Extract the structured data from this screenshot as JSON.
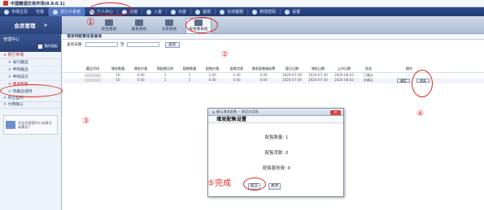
{
  "app": {
    "title": "中国糖酒交易市场(8.0.0.1)"
  },
  "topnav": {
    "items": [
      {
        "label": "市场主页",
        "icon": "home-icon"
      },
      {
        "label": "交易",
        "icon": "trade-icon"
      },
      {
        "label": "发行子系统",
        "icon": "issue-icon",
        "active": true
      },
      {
        "label": "个人中心",
        "icon": "user-icon"
      },
      {
        "label": "充值",
        "icon": "recharge-icon"
      },
      {
        "label": "入金",
        "icon": "deposit-icon"
      },
      {
        "label": "出金",
        "icon": "withdraw-icon"
      },
      {
        "label": "提现",
        "icon": "cash-icon"
      },
      {
        "label": "在线客服",
        "icon": "service-icon"
      },
      {
        "label": "修改密码",
        "icon": "key-icon"
      },
      {
        "label": "设置",
        "icon": "settings-icon"
      }
    ]
  },
  "subbar": {
    "member_label": "会员管理",
    "arrow": ">",
    "tabs": [
      {
        "label": "综合系统",
        "icon": "overview-icon"
      },
      {
        "label": "报表系统",
        "icon": "report-icon"
      },
      {
        "label": "仓单系统",
        "icon": "warehouse-icon"
      },
      {
        "label": "投资者系统",
        "icon": "investor-icon",
        "active": true
      }
    ]
  },
  "sidebar": {
    "header": "管理中心",
    "header_link": "我的面板",
    "groups": [
      {
        "label": "发行市场",
        "type": "group",
        "prefix": "∨"
      },
      {
        "label": "发行藏品",
        "type": "sub",
        "prefix": ">"
      },
      {
        "label": "申购藏品",
        "type": "sub",
        "prefix": ">"
      },
      {
        "label": "申购成交",
        "type": "sub",
        "prefix": ">"
      },
      {
        "label": "增发配售",
        "type": "sub",
        "prefix": ">"
      },
      {
        "label": "持藏品增持",
        "type": "sub",
        "prefix": ">"
      },
      {
        "label": "持仓盈利",
        "type": "row",
        "prefix": ">"
      },
      {
        "label": "付费确认",
        "type": "row",
        "prefix": ">"
      }
    ],
    "card_text": "对会员管理中心有意见或建议?"
  },
  "main": {
    "page_title": "增发待配售信息查询",
    "filter": {
      "date_label": "查询日期:",
      "to_label": "至",
      "query_button": "查询"
    },
    "columns": [
      "藏品代码",
      "增发数量",
      "增发价格",
      "预配售比例",
      "配售数量",
      "配售价格",
      "配售货款",
      "增发配售服务费",
      "登记日期",
      "增发日期",
      "上市日期",
      "状态",
      "操作"
    ],
    "rows": [
      {
        "code": "",
        "qty": "10",
        "price": "0.00",
        "ratio": "1",
        "alloc": "1",
        "alloc_price": "1.00",
        "payment": "1.00",
        "fee": "0.00",
        "reg_date": "2020-07-29",
        "issue_date": "2020-07-30",
        "list_date": "2020-08-03",
        "status": "已确认",
        "actions": [
          "--"
        ]
      },
      {
        "code": "",
        "qty": "10",
        "price": "0.00",
        "ratio": "1",
        "alloc": "1",
        "alloc_price": "0.00",
        "payment": "0.00",
        "fee": "0.00",
        "reg_date": "2020-07-29",
        "issue_date": "2020-07-30",
        "list_date": "2020-08-03",
        "status": "未确认",
        "actions": [
          "确定",
          "放弃"
        ]
      }
    ]
  },
  "modal": {
    "title": "确认增发配售 -- 网页对话框",
    "close": "×",
    "heading": "增发配售设置",
    "lines": [
      {
        "label": "配售数量:",
        "value": "1"
      },
      {
        "label": "配售货款:",
        "value": "0"
      },
      {
        "label": "配售服务费:",
        "value": "0"
      }
    ],
    "submit": "提交",
    "cancel": "关闭"
  },
  "annotations": [
    {
      "label": "①"
    },
    {
      "label": "②"
    },
    {
      "label": "③"
    },
    {
      "label": "④"
    },
    {
      "label": "⑤完成"
    }
  ],
  "colors": {
    "nav_bg": "#2e4c8a",
    "accent_red": "#e0261c",
    "side_group": "#b01e1e"
  }
}
